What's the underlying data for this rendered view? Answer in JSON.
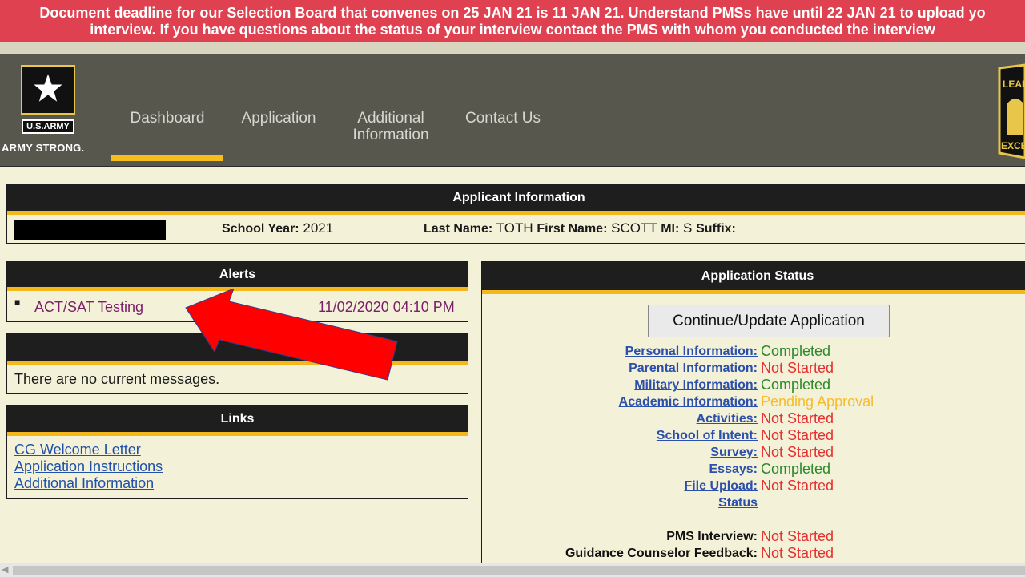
{
  "banner": {
    "line1": "Document deadline for our Selection Board that convenes on 25 JAN 21 is 11 JAN 21. Understand PMSs have until 22 JAN 21 to upload yo",
    "line2": "interview. If you have questions about the status of your interview contact the PMS with whom you conducted the interview"
  },
  "header": {
    "logo": {
      "top_text": "U.S.ARMY",
      "bottom_text": "ARMY STRONG."
    },
    "nav": [
      {
        "label": "Dashboard",
        "active": true
      },
      {
        "label": "Application"
      },
      {
        "label": "Additional Information"
      },
      {
        "label": "Contact Us"
      }
    ],
    "right_logo_text": [
      "LEAD",
      "EXCE"
    ]
  },
  "applicant": {
    "title": "Applicant Information",
    "school_year_label": "School Year:",
    "school_year": "2021",
    "last_name_label": "Last Name:",
    "last_name": "TOTH",
    "first_name_label": "First Name:",
    "first_name": "SCOTT",
    "mi_label": "MI:",
    "mi": "S",
    "suffix_label": "Suffix:"
  },
  "alerts": {
    "title": "Alerts",
    "items": [
      {
        "label": "ACT/SAT Testing",
        "date": "11/02/2020 04:10 PM"
      }
    ]
  },
  "messages": {
    "text": "There are no current messages."
  },
  "links": {
    "title": "Links",
    "items": [
      "CG Welcome Letter",
      "Application Instructions",
      "Additional Information"
    ]
  },
  "status": {
    "title": "Application Status",
    "button": "Continue/Update Application",
    "rows": [
      {
        "label": "Personal Information:",
        "value": "Completed",
        "state": "green"
      },
      {
        "label": "Parental Information:",
        "value": "Not Started",
        "state": "red"
      },
      {
        "label": "Military Information:",
        "value": "Completed",
        "state": "green"
      },
      {
        "label": "Academic Information:",
        "value": "Pending Approval",
        "state": "yellow"
      },
      {
        "label": "Activities:",
        "value": "Not Started",
        "state": "red"
      },
      {
        "label": "School of Intent:",
        "value": "Not Started",
        "state": "red"
      },
      {
        "label": "Survey:",
        "value": "Not Started",
        "state": "red"
      },
      {
        "label": "Essays:",
        "value": "Completed",
        "state": "green"
      },
      {
        "label": "File Upload:",
        "value": "Not Started",
        "state": "red"
      },
      {
        "label": "Status",
        "value": ""
      }
    ],
    "extra_rows": [
      {
        "label": "PMS Interview:",
        "value": "Not Started",
        "state": "red"
      },
      {
        "label": "Guidance Counselor Feedback:",
        "value": "Not Started",
        "state": "red"
      }
    ]
  },
  "colors": {
    "banner_bg": "#e04150",
    "nav_bg": "#58574d",
    "accent": "#f4b81a",
    "page_bg": "#f3f1d8",
    "completed": "#2a8a2a",
    "not_started": "#e53030",
    "pending": "#f5bd2d",
    "annotation_arrow": "#ff0000"
  }
}
